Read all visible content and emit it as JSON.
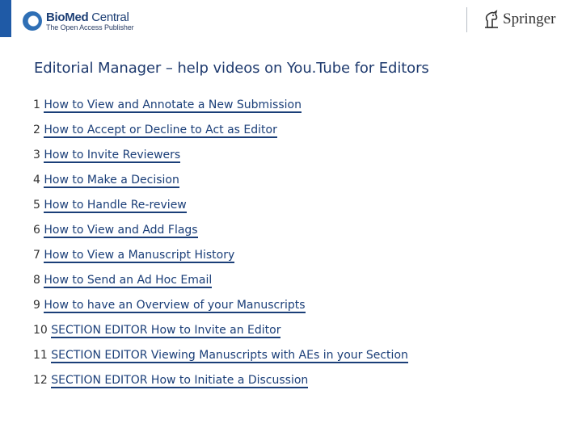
{
  "header": {
    "biomed_logo": {
      "name_bold": "BioMed",
      "name_light": " Central",
      "tagline": "The Open Access Publisher",
      "icon": "biomed-circle-icon",
      "color": "#1d3f75"
    },
    "springer_logo": {
      "name": "Springer",
      "icon": "springer-horse-icon"
    }
  },
  "main": {
    "title": "Editorial Manager – help videos on You.Tube for Editors",
    "links": [
      {
        "num": "1",
        "label": "How to View and Annotate a New Submission"
      },
      {
        "num": "2",
        "label": "How to Accept or Decline to Act as Editor"
      },
      {
        "num": "3",
        "label": "How to Invite Reviewers"
      },
      {
        "num": "4",
        "label": "How to Make a Decision"
      },
      {
        "num": "5",
        "label": "How to Handle Re-review"
      },
      {
        "num": "6",
        "label": "How to View and Add Flags"
      },
      {
        "num": "7",
        "label": "How to View a Manuscript History"
      },
      {
        "num": "8",
        "label": "How to Send an Ad Hoc Email"
      },
      {
        "num": "9",
        "label": "How to have an Overview of your Manuscripts"
      },
      {
        "num": "10",
        "label": "SECTION EDITOR How to Invite an Editor"
      },
      {
        "num": "11",
        "label": "SECTION EDITOR Viewing Manuscripts with AEs in your Section"
      },
      {
        "num": "12",
        "label": "SECTION EDITOR How to Initiate a Discussion"
      }
    ]
  },
  "colors": {
    "title": "#1e3a6e",
    "link": "#1a3e78",
    "accent_bar": "#1f5aa6"
  }
}
